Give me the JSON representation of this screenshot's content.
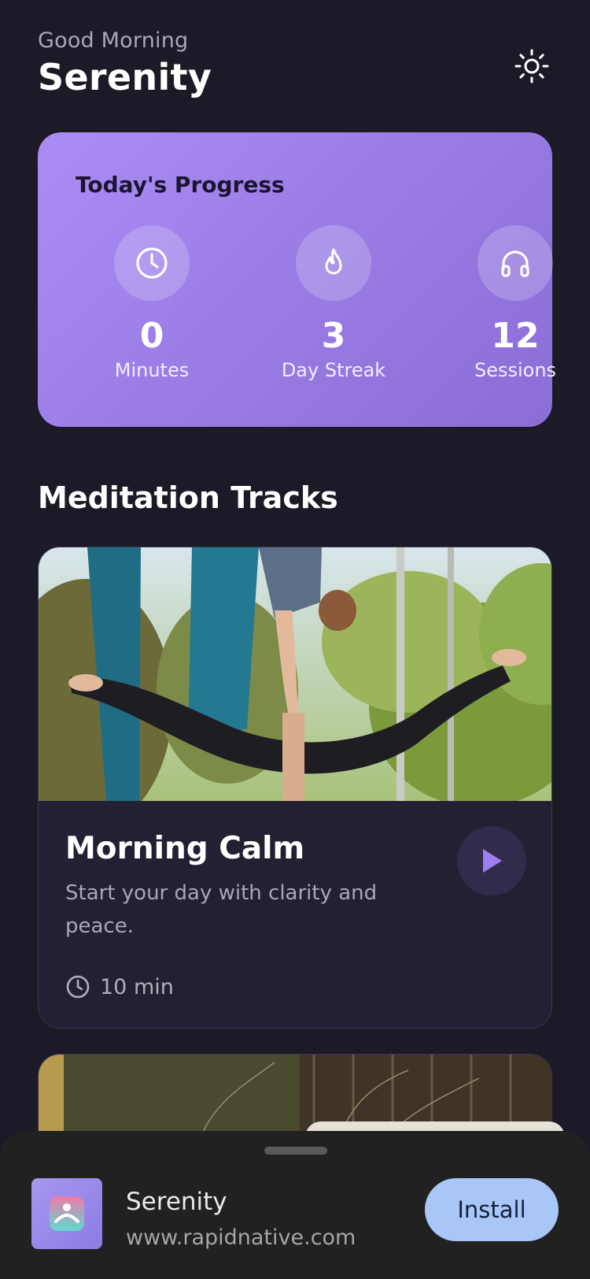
{
  "header": {
    "greeting": "Good Morning",
    "username": "Serenity",
    "theme_icon": "sun-icon"
  },
  "progress": {
    "title": "Today's Progress",
    "stats": [
      {
        "icon": "clock-icon",
        "value": "0",
        "label": "Minutes"
      },
      {
        "icon": "flame-icon",
        "value": "3",
        "label": "Day Streak"
      },
      {
        "icon": "headphones-icon",
        "value": "12",
        "label": "Sessions"
      }
    ]
  },
  "tracks": {
    "section_title": "Meditation Tracks",
    "items": [
      {
        "title": "Morning Calm",
        "description": "Start your day with clarity and peace.",
        "duration": "10 min"
      }
    ]
  },
  "install_banner": {
    "app_name": "Serenity",
    "url": "www.rapidnative.com",
    "install_label": "Install"
  },
  "colors": {
    "background": "#1b1a26",
    "card_gradient_start": "#ab8cf5",
    "card_gradient_end": "#8a6ed6",
    "accent": "#9d7ff0",
    "install_button": "#a9c6f8"
  }
}
